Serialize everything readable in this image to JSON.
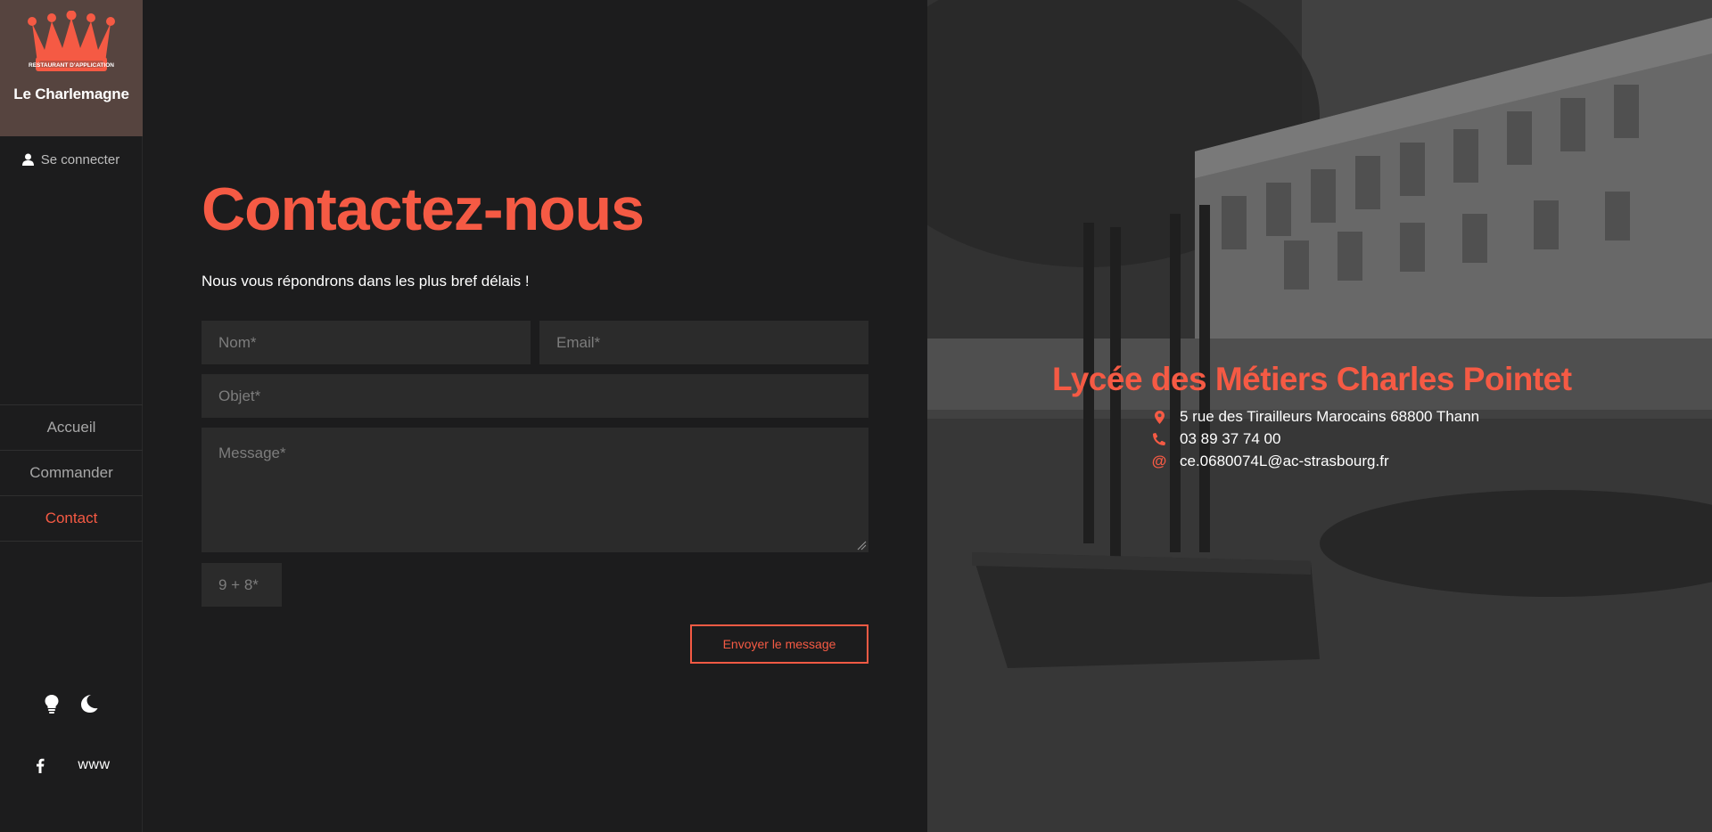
{
  "brand": {
    "badge_text": "RESTAURANT D'APPLICATION",
    "name": "Le Charlemagne",
    "accent_color": "#f55a44"
  },
  "sidebar": {
    "login_label": "Se connecter",
    "login_icon": "user-icon",
    "nav": [
      {
        "label": "Accueil",
        "active": false
      },
      {
        "label": "Commander",
        "active": false
      },
      {
        "label": "Contact",
        "active": true
      }
    ],
    "theme_icons": [
      "lightbulb-icon",
      "moon-icon"
    ],
    "social": {
      "facebook_icon": "facebook-icon",
      "www_label": "www"
    }
  },
  "contact_form": {
    "title": "Contactez-nous",
    "subtitle": "Nous vous répondrons dans les plus bref délais !",
    "name_placeholder": "Nom*",
    "email_placeholder": "Email*",
    "subject_placeholder": "Objet*",
    "message_placeholder": "Message*",
    "captcha_placeholder": "9 + 8*",
    "submit_label": "Envoyer le message"
  },
  "school_info": {
    "name": "Lycée des Métiers Charles Pointet",
    "address": "5 rue des Tirailleurs Marocains 68800 Thann",
    "phone": "03 89 37 74 00",
    "email": "ce.0680074L@ac-strasbourg.fr",
    "address_icon": "map-marker-icon",
    "phone_icon": "phone-icon",
    "email_icon": "at-icon"
  }
}
